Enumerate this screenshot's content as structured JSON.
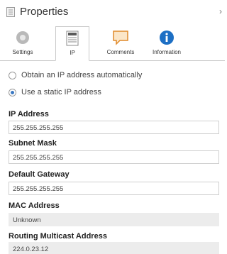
{
  "panel": {
    "title": "Properties"
  },
  "tabs": [
    {
      "label": "Settings",
      "icon": "gear-icon"
    },
    {
      "label": "IP",
      "icon": "ip-document-icon",
      "active": true
    },
    {
      "label": "Comments",
      "icon": "comment-icon"
    },
    {
      "label": "Information",
      "icon": "info-icon"
    }
  ],
  "ip_mode": {
    "options": [
      {
        "label": "Obtain an IP address automatically",
        "checked": false
      },
      {
        "label": "Use a static IP address",
        "checked": true
      }
    ]
  },
  "fields": {
    "ip_address": {
      "label": "IP Address",
      "value": "255.255.255.255"
    },
    "subnet_mask": {
      "label": "Subnet Mask",
      "value": "255.255.255.255"
    },
    "default_gateway": {
      "label": "Default Gateway",
      "value": "255.255.255.255"
    },
    "mac_address": {
      "label": "MAC Address",
      "value": "Unknown"
    },
    "routing_multicast": {
      "label": "Routing Multicast Address",
      "value": "224.0.23.12"
    }
  },
  "colors": {
    "accent": "#3a78c2",
    "info_blue": "#1d6fc4",
    "comment_orange": "#e08a2a",
    "readonly_bg": "#ececec"
  }
}
